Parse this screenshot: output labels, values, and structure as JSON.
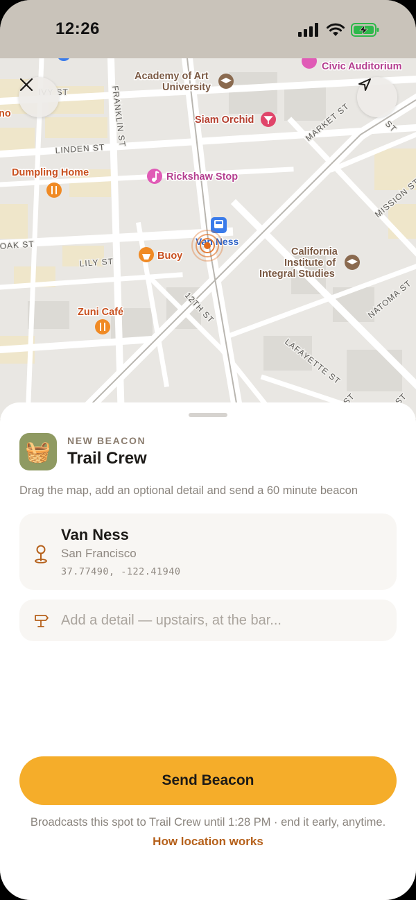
{
  "status_bar": {
    "time": "12:26"
  },
  "map": {
    "streets": [
      "IVY ST",
      "FRANKLIN ST",
      "LINDEN ST",
      "MARKET ST",
      "OAK ST",
      "LILY ST",
      "MISSION ST",
      "12TH ST",
      "NATOMA ST",
      "LAFAYETTE ST",
      "ST",
      "ST",
      "ST"
    ],
    "pois": {
      "academy": "Academy of Art",
      "academy_line2": "University",
      "civic": "Civic Auditorium",
      "siam": "Siam Orchid",
      "dumpling": "Dumpling Home",
      "rickshaw": "Rickshaw Stop",
      "van_ness": "Van Ness",
      "buoy": "Buoy",
      "ciis_1": "California",
      "ciis_2": "Institute of",
      "ciis_3": "Integral Studies",
      "zuni": "Zuni Café",
      "partial_left": "no"
    },
    "colors": {
      "food": "#f08a24",
      "music": "#e05bb6",
      "edu": "#8a6a4f",
      "transit": "#3a7bea",
      "beacon": "#e06a1a"
    }
  },
  "sheet": {
    "eyebrow": "NEW BEACON",
    "crew_name": "Trail Crew",
    "crew_emoji": "🧺",
    "hint": "Drag the map, add an optional detail and send a 60 minute beacon",
    "location": {
      "title": "Van Ness",
      "city": "San Francisco",
      "coords": "37.77490, -122.41940"
    },
    "detail": {
      "value": "",
      "placeholder": "Add a detail — upstairs, at the bar..."
    },
    "send_label": "Send Beacon",
    "footer_note": "Broadcasts this spot to Trail Crew until 1:28 PM · end it early, anytime.",
    "footer_link": "How location works",
    "accent": "#f5ad2a",
    "link_color": "#b5601a"
  }
}
